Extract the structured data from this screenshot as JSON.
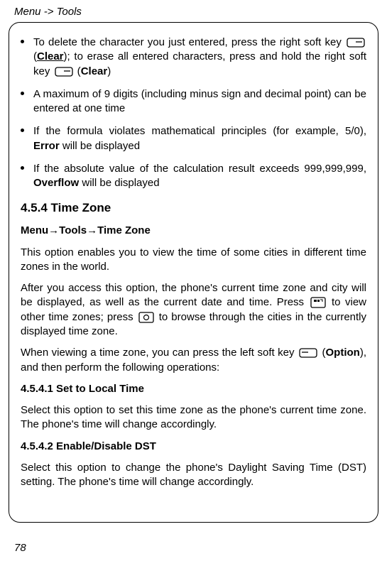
{
  "header": "Menu -> Tools",
  "bullets": {
    "b1_a": "To delete the character you just entered, press the right soft key ",
    "b1_b": " (",
    "b1_clear1": "Clear",
    "b1_c": "); to erase all entered characters, press and hold the right soft key ",
    "b1_d": " (",
    "b1_clear2": "Clear",
    "b1_e": ")",
    "b2": "A maximum of 9 digits (including minus sign and decimal point) can be entered at one time",
    "b3_a": "If the formula violates mathematical principles (for example, 5/0), ",
    "b3_err": "Error",
    "b3_b": " will be displayed",
    "b4_a": "If the absolute value of the calculation result exceeds 999,999,999, ",
    "b4_ovf": "Overflow",
    "b4_b": " will be displayed"
  },
  "section_title": "4.5.4 Time Zone",
  "breadcrumb": {
    "a": "Menu",
    "b": "Tools",
    "c": "Time Zone"
  },
  "p1": "This option enables you to view the time of some cities in different time zones in the world.",
  "p2_a": "After you access this option, the phone's current time zone and city will be displayed, as well as the current date and time. Press ",
  "p2_b": " to view other time zones; press ",
  "p2_c": " to browse through the cities in the currently displayed time zone.",
  "p3_a": "When viewing a time zone, you can press the left soft key ",
  "p3_b": " (",
  "p3_opt": "Option",
  "p3_c": "), and then perform the following operations:",
  "sub1_title": "4.5.4.1 Set to Local Time",
  "sub1_body": "Select this option to set this time zone as the phone's current time zone. The phone's time will change accordingly.",
  "sub2_title": "4.5.4.2 Enable/Disable DST",
  "sub2_body": "Select this option to change the phone's Daylight Saving Time (DST) setting. The phone's time will change accordingly.",
  "page_number": "78"
}
